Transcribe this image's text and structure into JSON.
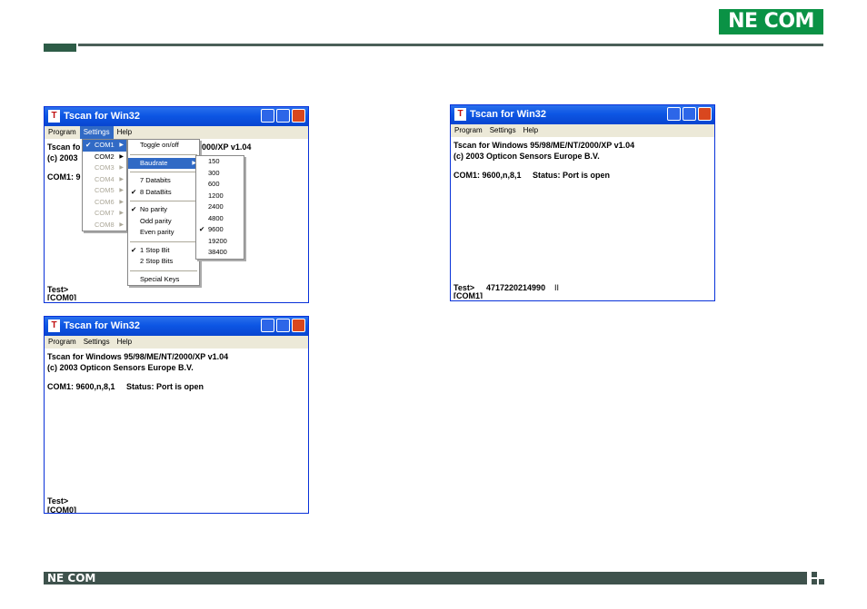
{
  "brand": {
    "logo": "NE COM",
    "footer_logo": "NE COM",
    "accent": "#0a9245"
  },
  "window": {
    "title": "Tscan for Win32",
    "menu": [
      "Program",
      "Settings",
      "Help"
    ],
    "line1": "Tscan for Windows 95/98/ME/NT/2000/XP v1.04",
    "line2": "(c) 2003 Opticon Sensors Europe B.V."
  },
  "win1": {
    "partial_line1a": "Tscan fo",
    "partial_line1b": "2000/XP v1.04",
    "partial_line2": "(c) 2003",
    "partial_line3": "COM1: 9",
    "prompt": "Test>",
    "com": "[COM0]"
  },
  "ports_menu": [
    "COM1",
    "COM2",
    "COM3",
    "COM4",
    "COM5",
    "COM6",
    "COM7",
    "COM8"
  ],
  "settings_menu": {
    "toggle": "Toggle on/off",
    "baudrate": "Baudrate",
    "databits": [
      "7 Databits",
      "8 DataBits"
    ],
    "parity": [
      "No parity",
      "Odd parity",
      "Even parity"
    ],
    "stopbits": [
      "1 Stop Bit",
      "2 Stop Bits"
    ],
    "special": "Special Keys"
  },
  "baud_menu": [
    "150",
    "300",
    "600",
    "1200",
    "2400",
    "4800",
    "9600",
    "19200",
    "38400"
  ],
  "win2": {
    "status": "COM1: 9600,n,8,1     Status: Port is open",
    "prompt": "Test>",
    "scan": "4717220214990",
    "cursor": "II",
    "com": "[COM1]"
  },
  "win3": {
    "status": "COM1: 9600,n,8,1     Status: Port is open",
    "prompt": "Test>",
    "com": "[COM0]"
  }
}
